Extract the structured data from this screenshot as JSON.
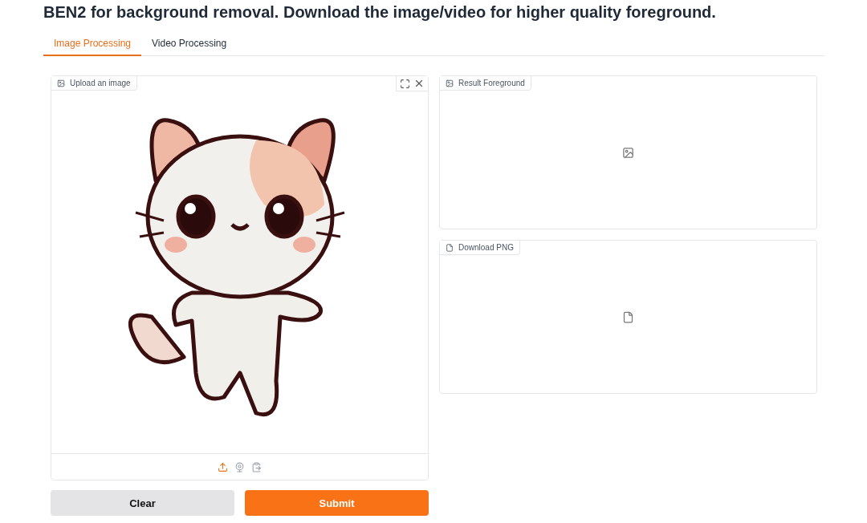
{
  "heading": "BEN2 for background removal. Download the image/video for higher quality foreground.",
  "tabs": [
    {
      "label": "Image Processing",
      "selected": true
    },
    {
      "label": "Video Processing",
      "selected": false
    }
  ],
  "input_panel": {
    "label": "Upload an image",
    "sources": [
      {
        "kind": "upload",
        "selected": true
      },
      {
        "kind": "webcam",
        "selected": false
      },
      {
        "kind": "clipboard",
        "selected": false
      }
    ]
  },
  "result_panel": {
    "label": "Result Foreground"
  },
  "download_panel": {
    "label": "Download PNG"
  },
  "buttons": [
    {
      "label": "Clear",
      "kind": "secondary"
    },
    {
      "label": "Submit",
      "kind": "primary"
    }
  ]
}
